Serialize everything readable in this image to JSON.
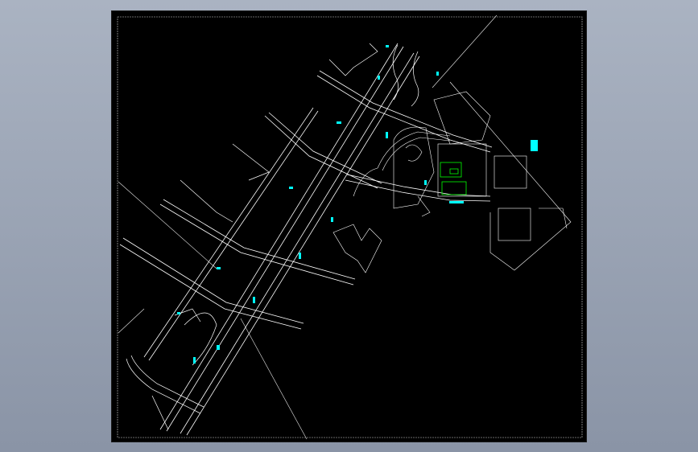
{
  "viewer": {
    "background_top": "#aab3c2",
    "background_bottom": "#8a94a6"
  },
  "drawing": {
    "sheet_color": "#000000",
    "line_color": "#ffffff",
    "annotation_color": "#00ffff",
    "building_color": "#00ff00"
  }
}
